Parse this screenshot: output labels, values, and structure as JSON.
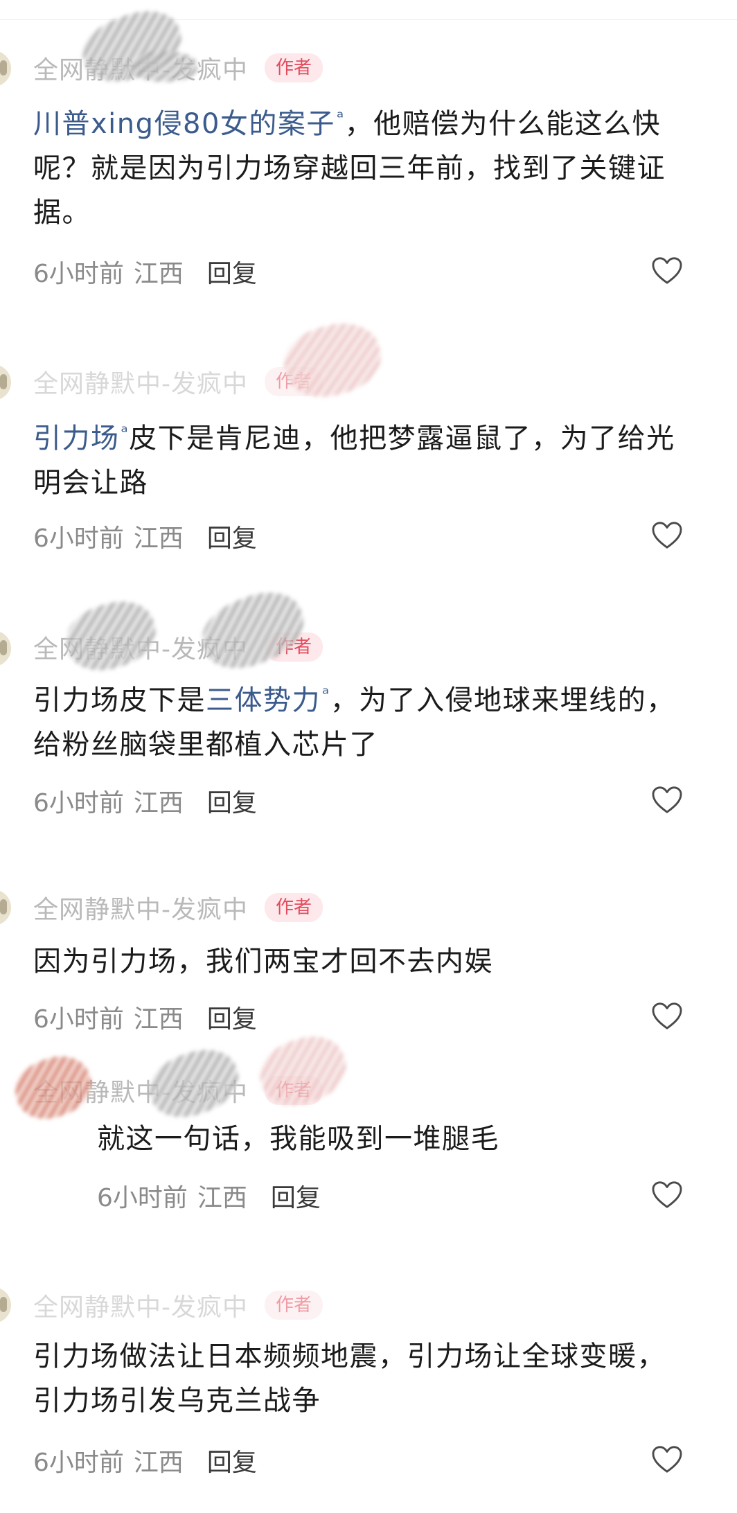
{
  "username": "全网静默中-发疯中",
  "author_badge": "作者",
  "search_mark": "ᵃ",
  "comments": [
    {
      "link": "川普xing侵80女的案子",
      "text": "，他赔偿为什么能这么快呢？就是因为引力场穿越回三年前，找到了关键证据。",
      "time": "6小时前",
      "location": "江西",
      "reply": "回复"
    },
    {
      "link": "引力场",
      "text": "皮下是肯尼迪，他把梦露逼鼠了，为了给光明会让路",
      "time": "6小时前",
      "location": "江西",
      "reply": "回复"
    },
    {
      "prefix": "引力场皮下是",
      "link": "三体势力",
      "text": "，为了入侵地球来埋线的，给粉丝脑袋里都植入芯片了",
      "time": "6小时前",
      "location": "江西",
      "reply": "回复"
    },
    {
      "text": "因为引力场，我们两宝才回不去内娱",
      "time": "6小时前",
      "location": "江西",
      "reply": "回复"
    },
    {
      "text": "就这一句话，我能吸到一堆腿毛",
      "time": "6小时前",
      "location": "江西",
      "reply": "回复"
    },
    {
      "text": "引力场做法让日本频频地震，引力场让全球变暖，引力场引发乌克兰战争",
      "time": "6小时前",
      "location": "江西",
      "reply": "回复"
    }
  ],
  "colors": {
    "link": "#3b5b8c",
    "badge_text": "#e34c5d",
    "badge_bg": "#fde8eb",
    "meta": "#8a8a8a"
  },
  "icons": {
    "like": "heart-outline-icon"
  }
}
